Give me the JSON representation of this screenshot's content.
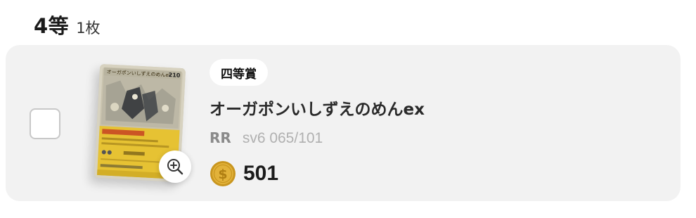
{
  "header": {
    "prize_title": "4等",
    "prize_count": "1枚"
  },
  "card": {
    "rank_badge": "四等賞",
    "name": "オーガポンいしずえのめんex",
    "rarity": "RR",
    "set_code": "sv6 065/101",
    "price": "501",
    "card_hp_text": "210",
    "card_title_text": "オーガポンいしずえのめんex"
  },
  "icons": {
    "zoom": "zoom-in-icon",
    "coin": "coin-icon"
  },
  "colors": {
    "row_background": "#f2f2f2",
    "coin_gold": "#e2b23a",
    "card_yellow": "#e6c233"
  }
}
